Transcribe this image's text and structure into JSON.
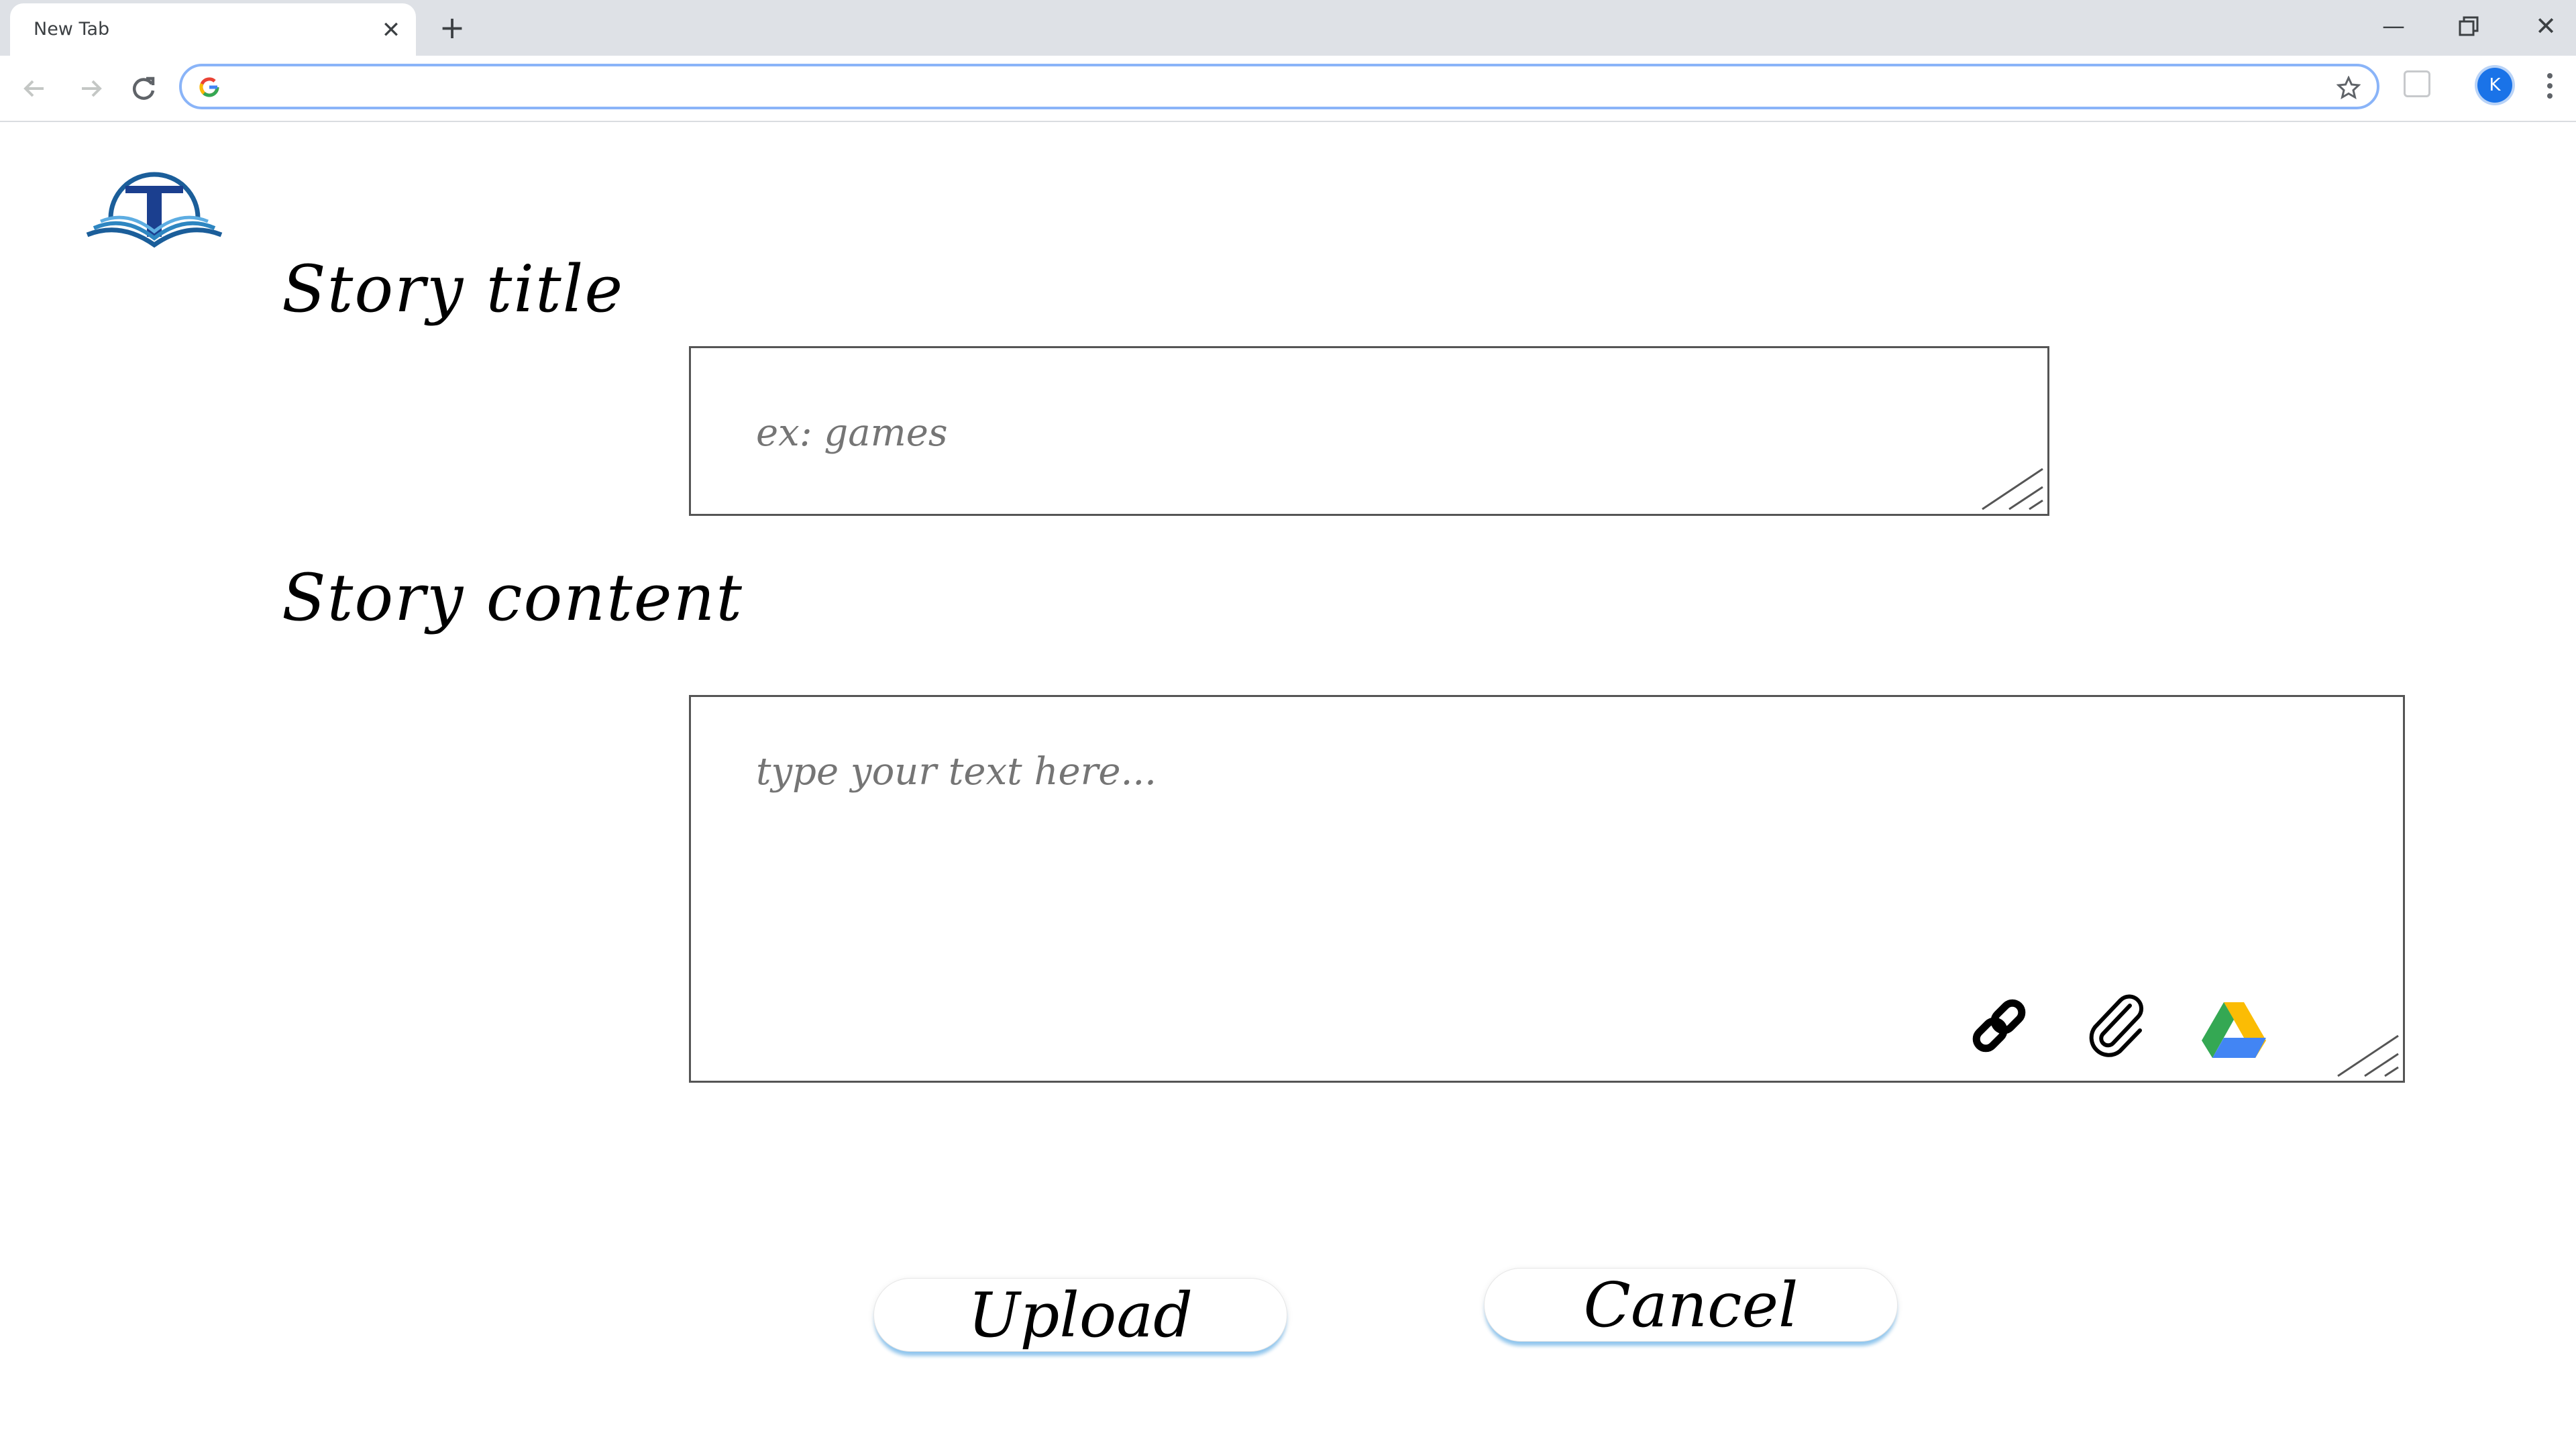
{
  "browser": {
    "tab_title": "New Tab",
    "tab_close_glyph": "✕",
    "new_tab_glyph": "+",
    "window_controls": {
      "minimize": "—",
      "close": "✕"
    },
    "address_bar": {
      "value": "",
      "placeholder": ""
    },
    "profile_initial": "K",
    "icons": [
      "back-arrow-icon",
      "forward-arrow-icon",
      "reload-icon",
      "google-g-icon",
      "bookmark-star-icon",
      "extension-icon",
      "kebab-menu-icon"
    ]
  },
  "page": {
    "logo": "open-book-T-logo",
    "title_section": {
      "label": "Story title",
      "placeholder": "ex: games",
      "value": ""
    },
    "content_section": {
      "label": "Story content",
      "placeholder": "type your text here...",
      "value": "",
      "tools": [
        "link-icon",
        "paperclip-icon",
        "google-drive-icon"
      ]
    },
    "actions": {
      "upload_label": "Upload",
      "cancel_label": "Cancel"
    }
  },
  "colors": {
    "placeholder": "#9a6f6f",
    "button_shadow": "#8ec5ee",
    "logo_blue": "#1b5e9a",
    "tabstrip": "#dee1e6"
  }
}
